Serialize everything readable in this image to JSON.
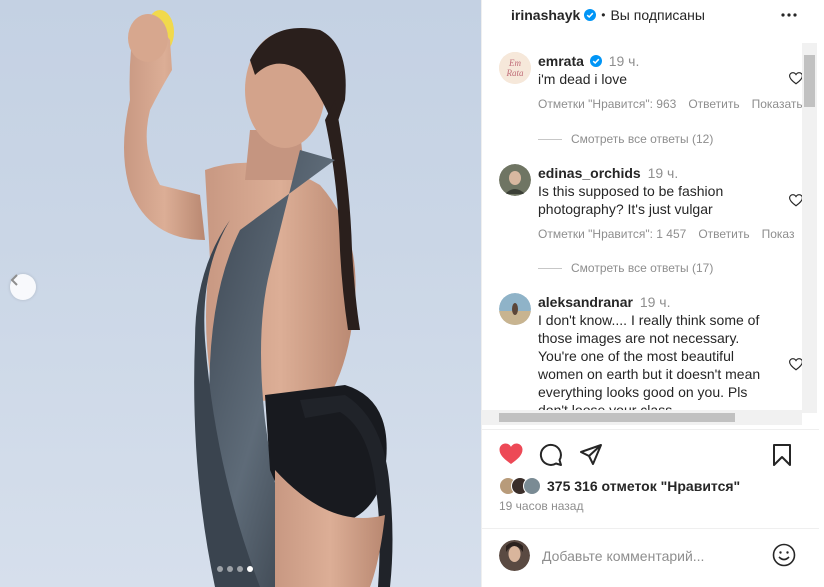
{
  "post": {
    "author": "irinashayk",
    "separator": "•",
    "follow_status": "Вы подписаны",
    "carousel": {
      "slides": 4,
      "active": 4
    }
  },
  "comments": [
    {
      "username": "emrata",
      "verified": true,
      "time": "19 ч.",
      "text": "i'm dead i love",
      "likes": "Отметки \"Нравится\": 963",
      "reply": "Ответить",
      "show": "Показать",
      "view_replies": "Смотреть все ответы (12)"
    },
    {
      "username": "edinas_orchids",
      "verified": false,
      "time": "19 ч.",
      "text": "Is this supposed to be fashion photography? It's just vulgar",
      "likes": "Отметки \"Нравится\": 1 457",
      "reply": "Ответить",
      "show": "Показ",
      "view_replies": "Смотреть все ответы (17)"
    },
    {
      "username": "aleksandranar",
      "verified": false,
      "time": "19 ч.",
      "text": "I don't know.... I really think some of those images are not necessary. You're one of the most beautiful women on earth but it doesn't mean everything looks good on you. Pls don't loose your class"
    }
  ],
  "footer": {
    "likes_count": "375 316 отметок \"Нравится\"",
    "posted": "19 часов назад",
    "comment_placeholder": "Добавьте комментарий..."
  },
  "colors": {
    "heart_active": "#ed4956",
    "verified": "#0095f6",
    "muted": "#8e8e8e",
    "text": "#262626"
  },
  "icons": [
    "more-icon",
    "heart-icon",
    "comment-icon",
    "share-icon",
    "bookmark-icon",
    "emoji-icon",
    "chevron-left-icon",
    "verified-icon"
  ]
}
